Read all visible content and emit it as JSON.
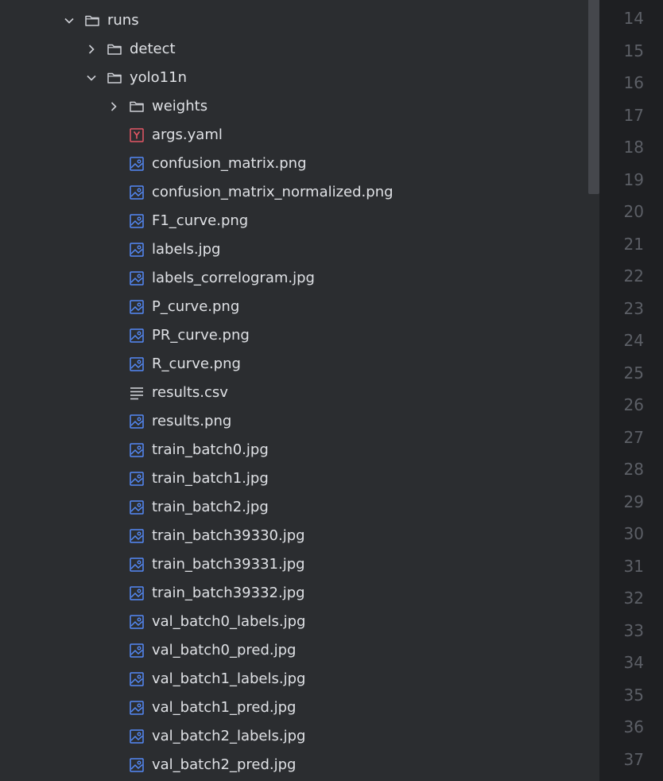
{
  "tree": {
    "items": [
      {
        "label": "runs",
        "depth": 0,
        "kind": "folder",
        "state": "expanded"
      },
      {
        "label": "detect",
        "depth": 1,
        "kind": "folder",
        "state": "collapsed"
      },
      {
        "label": "yolo11n",
        "depth": 1,
        "kind": "folder",
        "state": "expanded"
      },
      {
        "label": "weights",
        "depth": 2,
        "kind": "folder",
        "state": "collapsed"
      },
      {
        "label": "args.yaml",
        "depth": 2,
        "kind": "yaml"
      },
      {
        "label": "confusion_matrix.png",
        "depth": 2,
        "kind": "image"
      },
      {
        "label": "confusion_matrix_normalized.png",
        "depth": 2,
        "kind": "image"
      },
      {
        "label": "F1_curve.png",
        "depth": 2,
        "kind": "image"
      },
      {
        "label": "labels.jpg",
        "depth": 2,
        "kind": "image"
      },
      {
        "label": "labels_correlogram.jpg",
        "depth": 2,
        "kind": "image"
      },
      {
        "label": "P_curve.png",
        "depth": 2,
        "kind": "image"
      },
      {
        "label": "PR_curve.png",
        "depth": 2,
        "kind": "image"
      },
      {
        "label": "R_curve.png",
        "depth": 2,
        "kind": "image"
      },
      {
        "label": "results.csv",
        "depth": 2,
        "kind": "text"
      },
      {
        "label": "results.png",
        "depth": 2,
        "kind": "image"
      },
      {
        "label": "train_batch0.jpg",
        "depth": 2,
        "kind": "image"
      },
      {
        "label": "train_batch1.jpg",
        "depth": 2,
        "kind": "image"
      },
      {
        "label": "train_batch2.jpg",
        "depth": 2,
        "kind": "image"
      },
      {
        "label": "train_batch39330.jpg",
        "depth": 2,
        "kind": "image"
      },
      {
        "label": "train_batch39331.jpg",
        "depth": 2,
        "kind": "image"
      },
      {
        "label": "train_batch39332.jpg",
        "depth": 2,
        "kind": "image"
      },
      {
        "label": "val_batch0_labels.jpg",
        "depth": 2,
        "kind": "image"
      },
      {
        "label": "val_batch0_pred.jpg",
        "depth": 2,
        "kind": "image"
      },
      {
        "label": "val_batch1_labels.jpg",
        "depth": 2,
        "kind": "image"
      },
      {
        "label": "val_batch1_pred.jpg",
        "depth": 2,
        "kind": "image"
      },
      {
        "label": "val_batch2_labels.jpg",
        "depth": 2,
        "kind": "image"
      },
      {
        "label": "val_batch2_pred.jpg",
        "depth": 2,
        "kind": "image"
      }
    ]
  },
  "gutter": {
    "line_numbers": [
      "14",
      "15",
      "16",
      "17",
      "18",
      "19",
      "20",
      "21",
      "22",
      "23",
      "24",
      "25",
      "26",
      "27",
      "28",
      "29",
      "30",
      "31",
      "32",
      "33",
      "34",
      "35",
      "36",
      "37"
    ]
  },
  "icons": {
    "folder": "folder-icon",
    "image": "image-file-icon",
    "yaml": "yaml-file-icon",
    "text": "text-file-icon",
    "expanded": "chevron-down-icon",
    "collapsed": "chevron-right-icon"
  },
  "colors": {
    "panel_bg": "#2b2d30",
    "gutter_bg": "#1e1f22",
    "text": "#dfe1e5",
    "line_number": "#5c5f66",
    "image_icon": "#548af7",
    "yaml_icon": "#e55765",
    "folder_icon": "#ced0d6"
  }
}
